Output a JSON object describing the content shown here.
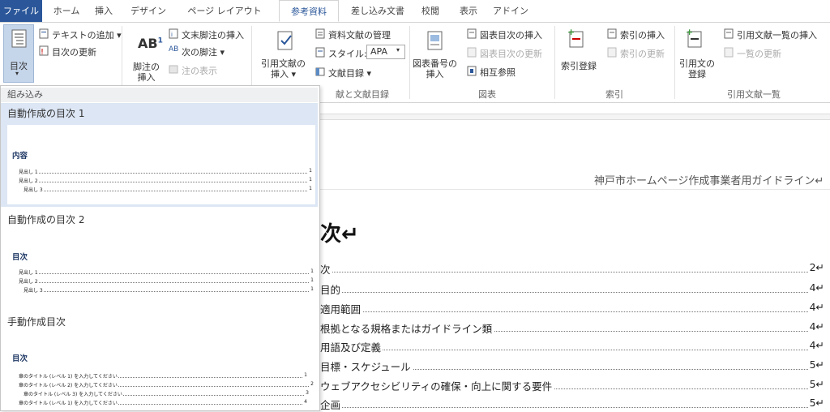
{
  "tabs": [
    "ファイル",
    "ホーム",
    "挿入",
    "デザイン",
    "ページ レイアウト",
    "参考資料",
    "差し込み文書",
    "校閲",
    "表示",
    "アドイン"
  ],
  "ribbon": {
    "toc_button": "目次",
    "add_text": "テキストの追加 ▾",
    "update_toc": "目次の更新",
    "endnote_insert": "文末脚注の挿入",
    "next_footnote": "次の脚注 ▾",
    "show_notes": "注の表示",
    "footnote_insert_l1": "脚注の",
    "footnote_insert_l2": "挿入",
    "citation_l1": "引用文献の",
    "citation_l2": "挿入 ▾",
    "manage_sources": "資料文献の管理",
    "style_label": "スタイル:",
    "style_value": "APA",
    "bibliography": "文献目録 ▾",
    "caption_l1": "図表番号の",
    "caption_l2": "挿入",
    "insert_tof": "図表目次の挿入",
    "update_tof": "図表目次の更新",
    "cross_ref": "相互参照",
    "mark_entry": "索引登録",
    "insert_index": "索引の挿入",
    "update_index": "索引の更新",
    "mark_citation_l1": "引用文の",
    "mark_citation_l2": "登録",
    "insert_toa": "引用文献一覧の挿入",
    "update_toa": "一覧の更新",
    "group_citations": "献と文献目録",
    "group_captions": "図表",
    "group_index": "索引",
    "group_toa": "引用文献一覧"
  },
  "gallery": {
    "section_builtin": "組み込み",
    "auto1_title": "自動作成の目次 1",
    "auto1_heading": "内容",
    "auto2_title": "自動作成の目次 2",
    "auto2_heading": "目次",
    "manual_title": "手動作成目次",
    "manual_heading": "目次",
    "auto_rows": [
      {
        "label": "見出し 1",
        "page": "1"
      },
      {
        "label": "見出し 2",
        "page": "1"
      },
      {
        "label": "見出し 3",
        "page": "1"
      }
    ],
    "manual_rows": [
      {
        "label": "章のタイトル (レベル 1) を入力してください",
        "page": "1"
      },
      {
        "label": "章のタイトル (レベル 2) を入力してください",
        "page": "2"
      },
      {
        "label": "章のタイトル (レベル 3) を入力してください",
        "page": "3"
      },
      {
        "label": "章のタイトル (レベル 1) を入力してください",
        "page": "4"
      }
    ]
  },
  "document": {
    "header": "神戸市ホームページ作成事業者用ガイドライン↵",
    "toc_title": "次↵",
    "entries": [
      {
        "title": "次",
        "page": "2↵"
      },
      {
        "title": "目的",
        "page": "4↵"
      },
      {
        "title": "適用範囲",
        "page": "4↵"
      },
      {
        "title": "根拠となる規格またはガイドライン類",
        "page": "4↵"
      },
      {
        "title": "用語及び定義",
        "page": "4↵"
      },
      {
        "title": "目標・スケジュール",
        "page": "5↵"
      },
      {
        "title": "ウェブアクセシビリティの確保・向上に関する要件",
        "page": "5↵"
      },
      {
        "title": "企画",
        "page": "5↵"
      }
    ]
  },
  "colors": {
    "file_tab": "#2b579a",
    "selected_item": "#dce6f4"
  }
}
